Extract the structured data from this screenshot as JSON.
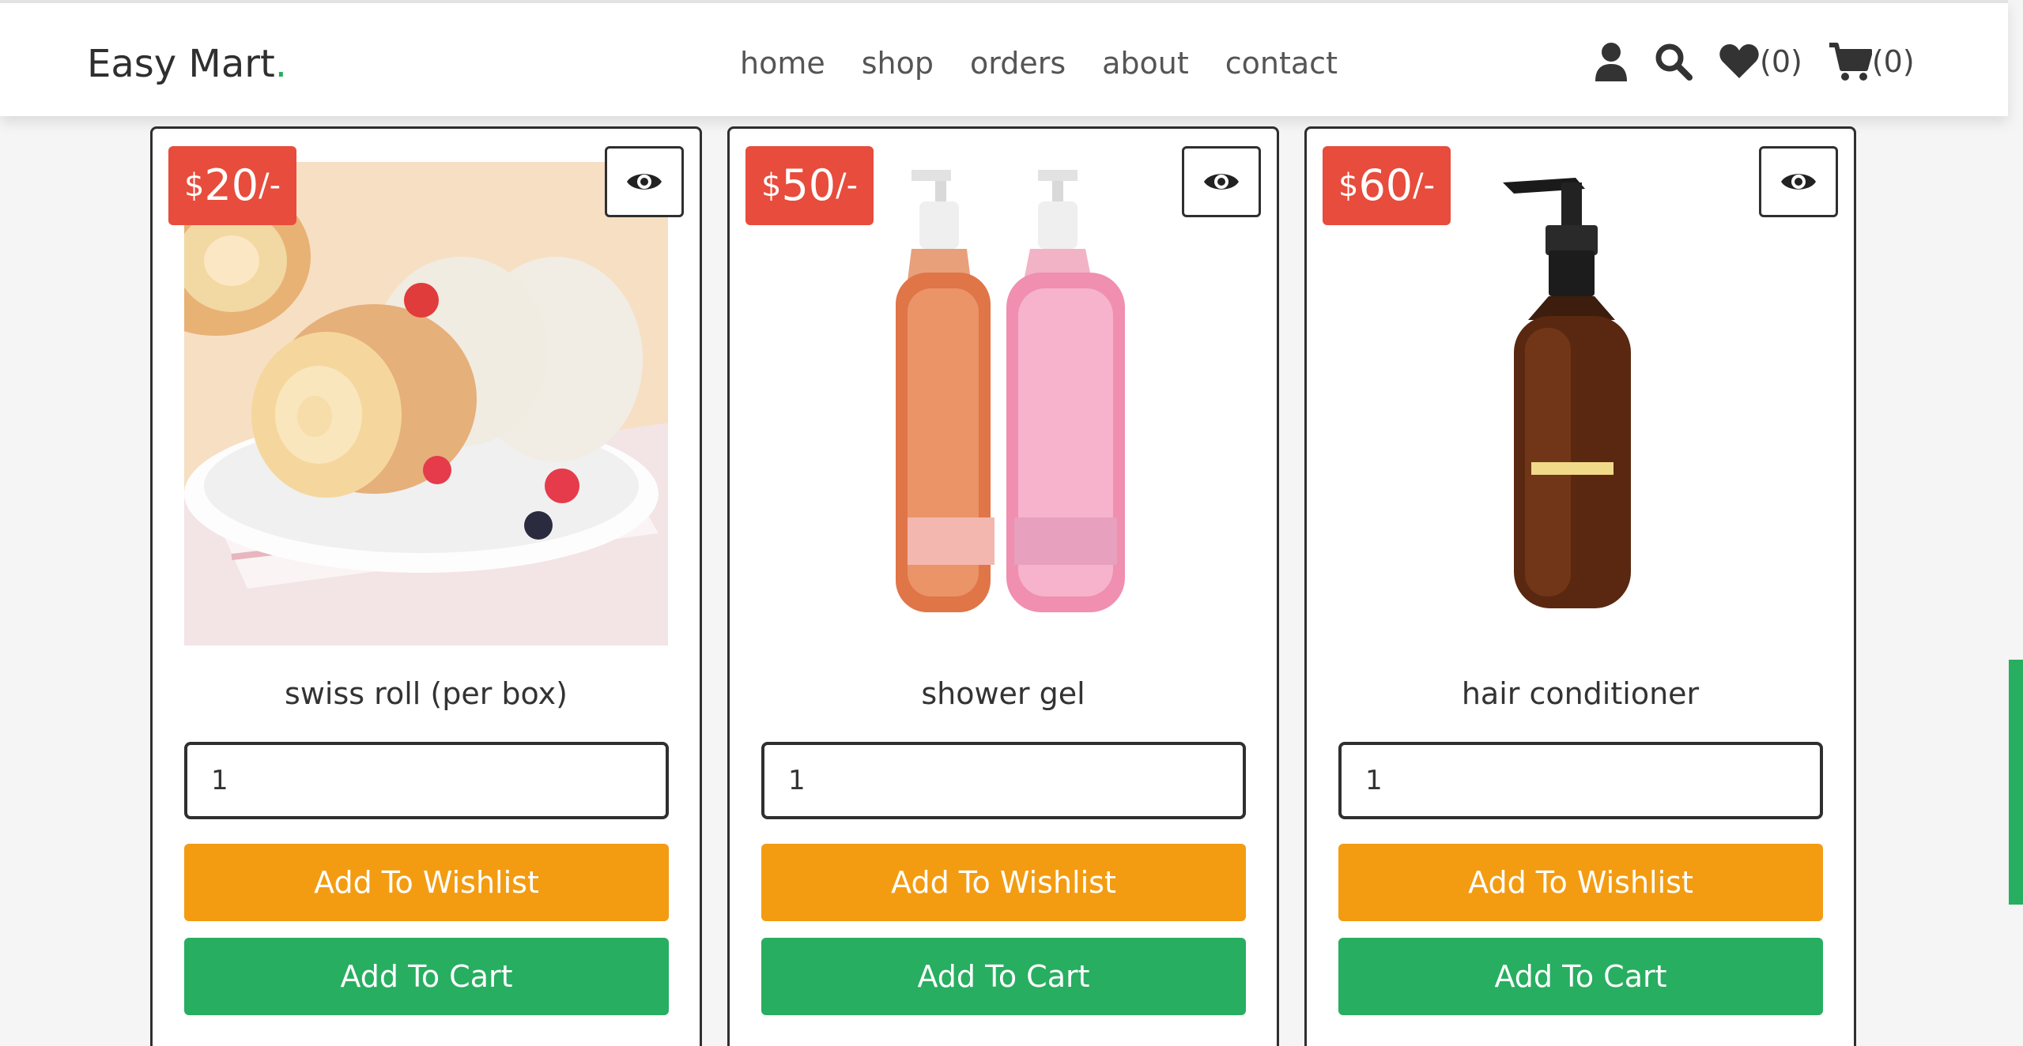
{
  "brand": {
    "name": "Easy Mart",
    "dot": "."
  },
  "nav": {
    "items": [
      {
        "label": "home"
      },
      {
        "label": "shop"
      },
      {
        "label": "orders"
      },
      {
        "label": "about"
      },
      {
        "label": "contact"
      }
    ]
  },
  "header_icons": {
    "user_icon": "user-icon",
    "search_icon": "search-icon",
    "wishlist_icon": "heart-icon",
    "wishlist_count": "(0)",
    "cart_icon": "cart-icon",
    "cart_count": "(0)"
  },
  "products": [
    {
      "currency": "$",
      "price": "20",
      "suffix": "/-",
      "name": "swiss roll (per box)",
      "quantity": "1",
      "wishlist_label": "Add To Wishlist",
      "cart_label": "Add To Cart",
      "view_icon": "eye-icon"
    },
    {
      "currency": "$",
      "price": "50",
      "suffix": "/-",
      "name": "shower gel",
      "quantity": "1",
      "wishlist_label": "Add To Wishlist",
      "cart_label": "Add To Cart",
      "view_icon": "eye-icon"
    },
    {
      "currency": "$",
      "price": "60",
      "suffix": "/-",
      "name": "hair conditioner",
      "quantity": "1",
      "wishlist_label": "Add To Wishlist",
      "cart_label": "Add To Cart",
      "view_icon": "eye-icon"
    }
  ],
  "colors": {
    "accent_green": "#27ae60",
    "price_red": "#e74c3c",
    "wishlist_orange": "#f39c12",
    "cart_green": "#27ae60"
  }
}
